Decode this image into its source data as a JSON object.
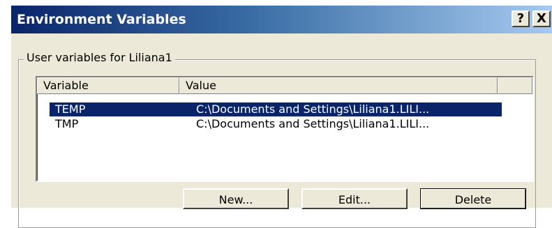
{
  "window": {
    "title": "Environment Variables",
    "help_button": "?",
    "close_button": "X"
  },
  "user_vars": {
    "group_label": "User variables for Liliana1",
    "columns": [
      "Variable",
      "Value"
    ],
    "rows": [
      {
        "variable": "TEMP",
        "value": "C:\\Documents and Settings\\Liliana1.LILI...",
        "selected": true
      },
      {
        "variable": "TMP",
        "value": "C:\\Documents and Settings\\Liliana1.LILI...",
        "selected": false
      }
    ],
    "buttons": {
      "new": "New...",
      "edit": "Edit...",
      "delete": "Delete"
    }
  },
  "colors": {
    "selection": "#0a246a",
    "dialog_bg": "#ece9d8"
  }
}
